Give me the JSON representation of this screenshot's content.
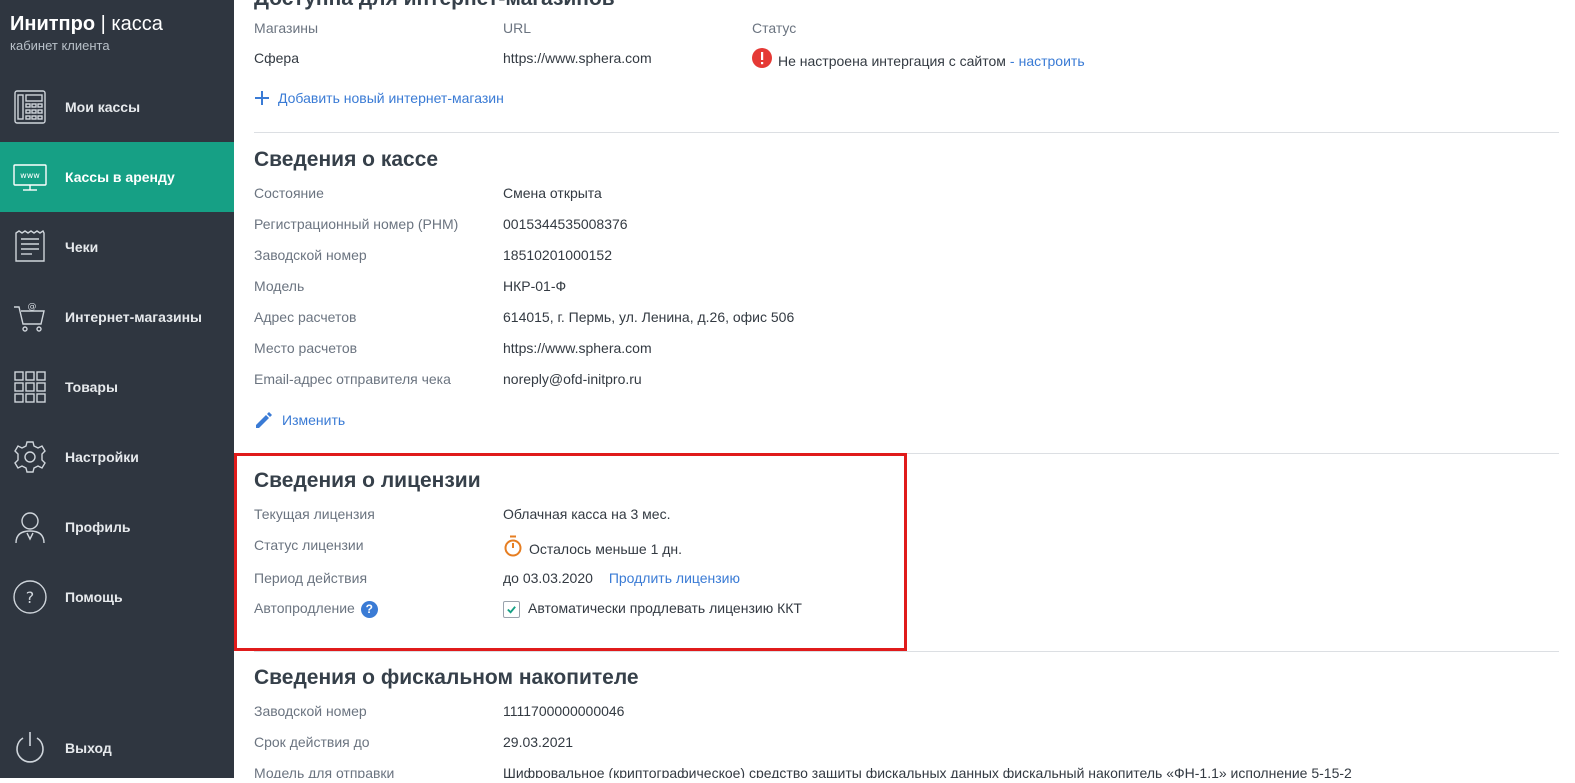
{
  "brand": {
    "name": "Инитпро",
    "separator": "|",
    "product": "касса",
    "subtitle": "кабинет клиента"
  },
  "nav": [
    {
      "label": "Мои кассы",
      "icon": "cash-register-icon",
      "active": false
    },
    {
      "label": "Кассы в аренду",
      "icon": "www-monitor-icon",
      "active": true
    },
    {
      "label": "Чеки",
      "icon": "receipt-icon",
      "active": false
    },
    {
      "label": "Интернет-магазины",
      "icon": "cart-icon",
      "active": false
    },
    {
      "label": "Товары",
      "icon": "grid-icon",
      "active": false
    },
    {
      "label": "Настройки",
      "icon": "gear-icon",
      "active": false
    },
    {
      "label": "Профиль",
      "icon": "user-icon",
      "active": false
    },
    {
      "label": "Помощь",
      "icon": "help-icon",
      "active": false
    }
  ],
  "logout": {
    "label": "Выход",
    "icon": "power-icon"
  },
  "stores": {
    "title": "Доступна для интернет-магазинов",
    "headers": {
      "store": "Магазины",
      "url": "URL",
      "status": "Статус"
    },
    "row": {
      "store": "Сфера",
      "url": "https://www.sphera.com",
      "status": "Не настроена интергация с сайтом",
      "status_link_prefix": "-",
      "status_link": "настроить"
    },
    "add_label": "Добавить новый интернет-магазин"
  },
  "kassa": {
    "title": "Сведения о кассе",
    "rows": [
      {
        "label": "Состояние",
        "value": "Смена открыта"
      },
      {
        "label": "Регистрационный номер (РНМ)",
        "value": "0015344535008376"
      },
      {
        "label": "Заводской номер",
        "value": "18510201000152"
      },
      {
        "label": "Модель",
        "value": "НКР-01-Ф"
      },
      {
        "label": "Адрес расчетов",
        "value": "614015, г. Пермь, ул. Ленина, д.26, офис 506"
      },
      {
        "label": "Место расчетов",
        "value": "https://www.sphera.com"
      },
      {
        "label": "Email-адрес отправителя чека",
        "value": "noreply@ofd-initpro.ru"
      }
    ],
    "edit_label": "Изменить"
  },
  "license": {
    "title": "Сведения о лицензии",
    "current_label": "Текущая лицензия",
    "current_value": "Облачная касса на 3 мес.",
    "status_label": "Статус лицензии",
    "status_value": "Осталось меньше 1 дн.",
    "period_label": "Период действия",
    "period_value": "до 03.03.2020",
    "extend_link": "Продлить лицензию",
    "auto_label": "Автопродление",
    "auto_help": "?",
    "auto_checkbox_label": "Автоматически продлевать лицензию ККТ",
    "auto_checked": true
  },
  "fn": {
    "title": "Сведения о фискальном накопителе",
    "rows": [
      {
        "label": "Заводской номер",
        "value": "1111700000000046"
      },
      {
        "label": "Срок действия до",
        "value": "29.03.2021"
      },
      {
        "label": "Модель для отправки",
        "value": "Шифровальное (криптографическое) средство защиты фискальных данных фискальный накопитель «ФН-1.1» исполнение 5-15-2"
      }
    ]
  },
  "colors": {
    "sidebar_bg": "#2f3640",
    "active_bg": "#16a085",
    "link": "#3a7bd5",
    "error": "#e53935",
    "timer": "#e67e22",
    "highlight": "#e01b1b"
  }
}
